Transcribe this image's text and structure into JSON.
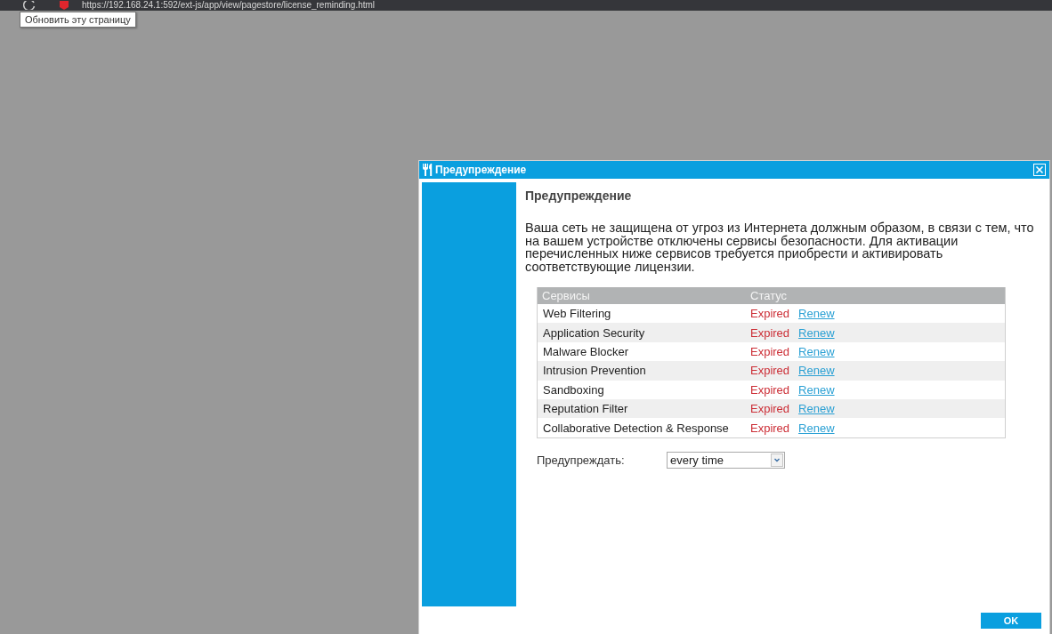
{
  "browser": {
    "address": "https://192.168.24.1:592/ext-js/app/view/pagestore/license_reminding.html",
    "tooltip": "Обновить эту страницу"
  },
  "dialog": {
    "title": "Предупреждение",
    "heading": "Предупреждение",
    "message": "Ваша сеть не защищена от угроз из Интернета должным образом, в связи с тем, что на вашем устройстве отключены сервисы безопасности. Для активации перечисленных ниже сервисов требуется приобрести и активировать соответствующие лицензии.",
    "table": {
      "columns": [
        "Сервисы",
        "Статус"
      ],
      "rows": [
        {
          "service": "Web Filtering",
          "status": "Expired",
          "action": "Renew"
        },
        {
          "service": "Application Security",
          "status": "Expired",
          "action": "Renew"
        },
        {
          "service": "Malware Blocker",
          "status": "Expired",
          "action": "Renew"
        },
        {
          "service": "Intrusion Prevention",
          "status": "Expired",
          "action": "Renew"
        },
        {
          "service": "Sandboxing",
          "status": "Expired",
          "action": "Renew"
        },
        {
          "service": "Reputation Filter",
          "status": "Expired",
          "action": "Renew"
        },
        {
          "service": "Collaborative Detection & Response",
          "status": "Expired",
          "action": "Renew"
        }
      ]
    },
    "remind": {
      "label": "Предупреждать:",
      "value": "every time"
    },
    "buttons": [
      "OK"
    ]
  }
}
